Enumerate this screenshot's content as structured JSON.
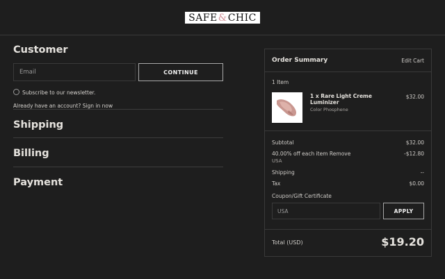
{
  "header": {
    "logo_left": "SAFE",
    "logo_amp": "&",
    "logo_right": "CHIC"
  },
  "customer": {
    "title": "Customer",
    "email_placeholder": "Email",
    "continue_label": "CONTINUE",
    "newsletter_label": "Subscribe to our newsletter.",
    "signin_text": "Already have an account? Sign in now"
  },
  "sections": {
    "shipping": "Shipping",
    "billing": "Billing",
    "payment": "Payment"
  },
  "summary": {
    "title": "Order Summary",
    "edit_cart": "Edit Cart",
    "item_count": "1 Item",
    "item": {
      "name_line1": "1 x Rare Light Creme",
      "name_line2": "Luminizer",
      "variant": "Color Phosphene",
      "price": "$32.00"
    },
    "subtotal_label": "Subtotal",
    "subtotal_value": "$32.00",
    "discount_label": "40.00% off each item Remove",
    "discount_sub": "USA",
    "discount_value": "-$12.80",
    "shipping_label": "Shipping",
    "shipping_value": "--",
    "tax_label": "Tax",
    "tax_value": "$0.00",
    "coupon_label": "Coupon/Gift Certificate",
    "coupon_value": "USA",
    "apply_label": "APPLY",
    "total_label": "Total (USD)",
    "total_value": "$19.20"
  }
}
